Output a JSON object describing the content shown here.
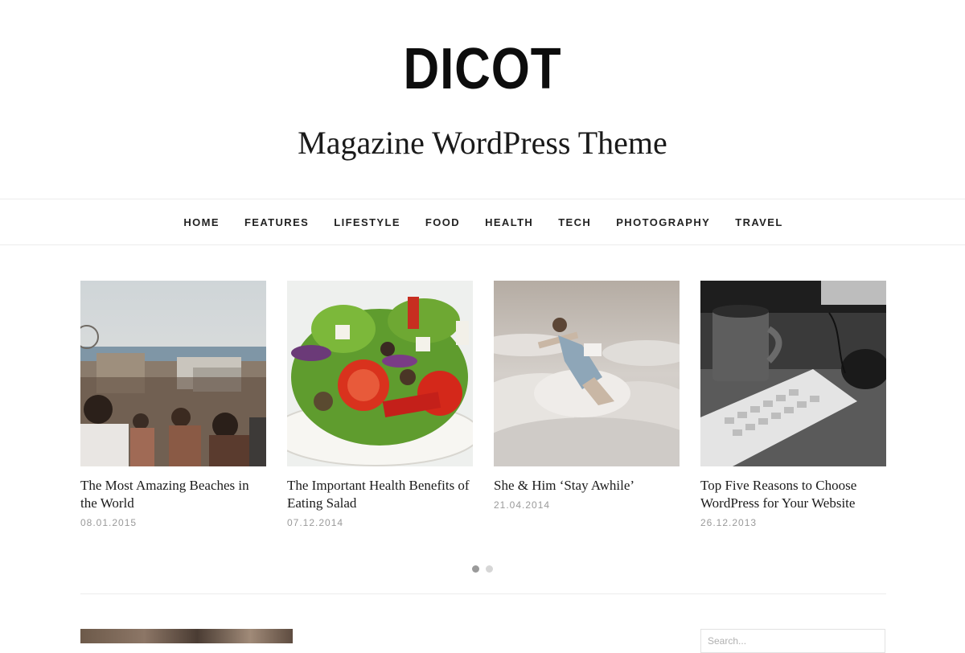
{
  "site": {
    "logo": "DICOT",
    "tagline": "Magazine WordPress Theme"
  },
  "nav": {
    "items": [
      "HOME",
      "FEATURES",
      "LIFESTYLE",
      "FOOD",
      "HEALTH",
      "TECH",
      "PHOTOGRAPHY",
      "TRAVEL"
    ]
  },
  "posts": [
    {
      "title": "The Most Amazing Beaches in the World",
      "date": "08.01.2015",
      "image": "beach-boardwalk-crowd"
    },
    {
      "title": "The Important Health Benefits of Eating Salad",
      "date": "07.12.2014",
      "image": "salad-plate"
    },
    {
      "title": "She & Him ‘Stay Awhile’",
      "date": "21.04.2014",
      "image": "woman-floating-clouds"
    },
    {
      "title": "Top Five Reasons to Choose WordPress for Your Website",
      "date": "26.12.2013",
      "image": "coffee-mug-keyboard"
    }
  ],
  "slider": {
    "pages": 2,
    "active": 1
  },
  "sidebar": {
    "search_placeholder": "Search..."
  }
}
